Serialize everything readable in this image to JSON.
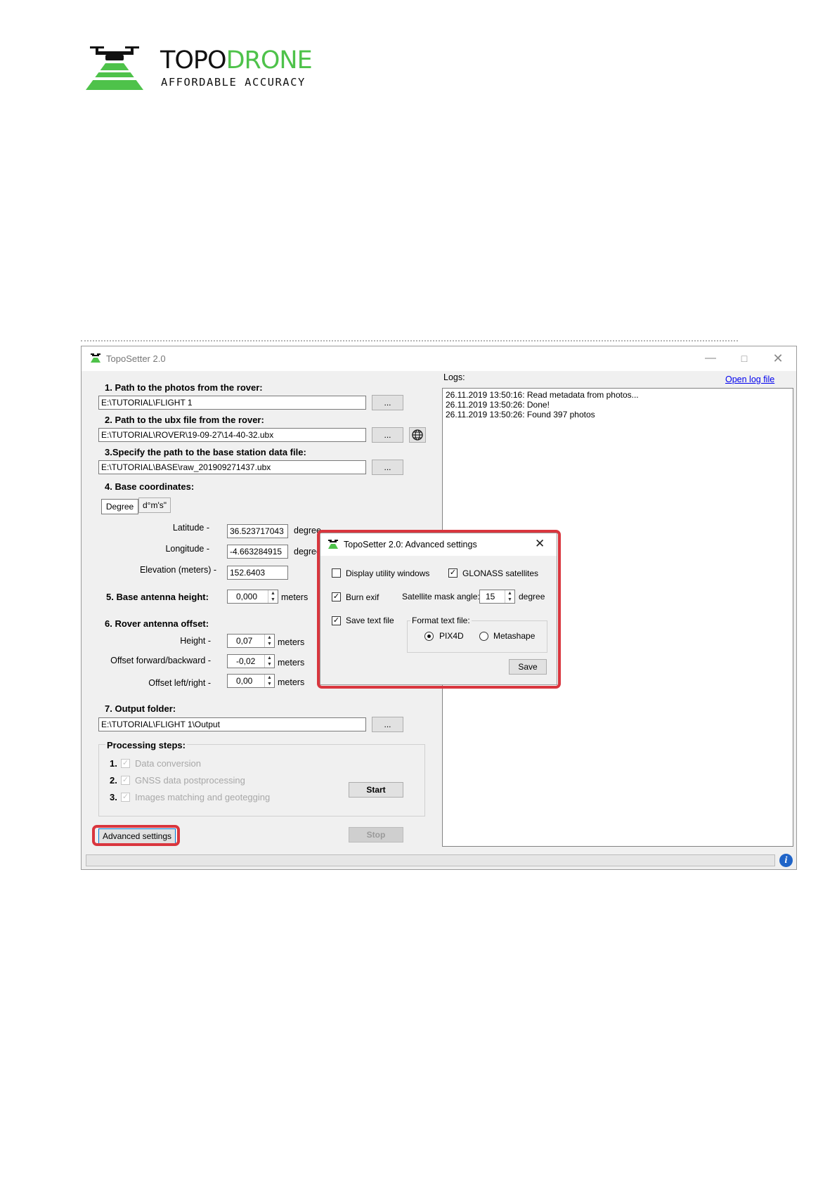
{
  "logo": {
    "brand_part1": "TOPO",
    "brand_part2": "DRONE",
    "tagline": "AFFORDABLE ACCURACY",
    "color_primary": "#4ec24a"
  },
  "main_window": {
    "title": "TopoSetter 2.0",
    "sections": {
      "photos_label": "1. Path to the photos from the rover:",
      "photos_path": "E:\\TUTORIAL\\FLIGHT 1",
      "ubx_label": "2. Path to the ubx file from the rover:",
      "ubx_path": "E:\\TUTORIAL\\ROVER\\19-09-27\\14-40-32.ubx",
      "base_label": "3.Specify the path to the base station data file:",
      "base_path": "E:\\TUTORIAL\\BASE\\raw_201909271437.ubx",
      "browse_label": "...",
      "coords_label": "4. Base coordinates:",
      "tab_degree": "Degree",
      "tab_dms": "d°m's\"",
      "latitude_label": "Latitude -",
      "latitude_value": "36.523717043",
      "longitude_label": "Longitude -",
      "longitude_value": "-4.663284915",
      "elevation_label": "Elevation (meters) -",
      "elevation_value": "152.6403",
      "degree_unit": "degree",
      "antenna_height_label": "5. Base antenna height:",
      "antenna_height_value": "0,000",
      "meters_unit": "meters",
      "rover_offset_label": "6. Rover antenna offset:",
      "height_label": "Height -",
      "height_value": "0,07",
      "offset_fb_label": "Offset forward/backward -",
      "offset_fb_value": "-0,02",
      "offset_lr_label": "Offset left/right -",
      "offset_lr_value": "0,00",
      "output_label": "7. Output folder:",
      "output_path": "E:\\TUTORIAL\\FLIGHT 1\\Output"
    },
    "processing": {
      "title": "Processing steps:",
      "steps": [
        {
          "num": "1.",
          "label": "Data conversion"
        },
        {
          "num": "2.",
          "label": "GNSS data postprocessing"
        },
        {
          "num": "3.",
          "label": "Images matching and geotegging"
        }
      ],
      "start_label": "Start",
      "stop_label": "Stop"
    },
    "advanced_label": "Advanced settings",
    "logs": {
      "title": "Logs:",
      "open_link": "Open log file",
      "lines": [
        "26.11.2019 13:50:16: Read metadata from photos...",
        "26.11.2019 13:50:26: Done!",
        "26.11.2019 13:50:26: Found 397 photos"
      ]
    },
    "info_glyph": "i"
  },
  "dialog": {
    "title": "TopoSetter 2.0: Advanced settings",
    "display_utility": "Display utility windows",
    "glonass": "GLONASS satellites",
    "burn_exif": "Burn exif",
    "mask_angle_label": "Satellite mask angle:",
    "mask_angle_value": "15",
    "mask_angle_unit": "degree",
    "save_text": "Save text file",
    "format_label": "Format text file:",
    "pix4d": "PIX4D",
    "metashape": "Metashape",
    "save_button": "Save"
  },
  "highlight_color": "#d9363e"
}
